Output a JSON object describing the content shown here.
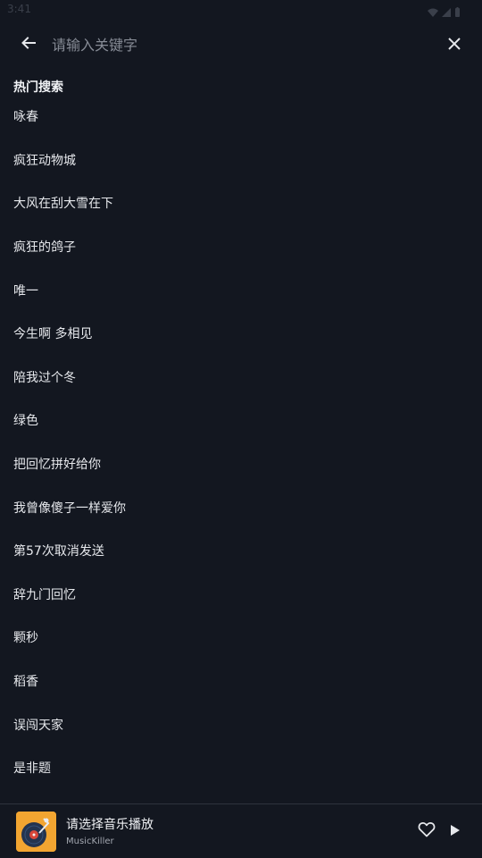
{
  "status_bar": {
    "time": "3:41",
    "icons": [
      "wifi-icon",
      "signal-icon",
      "battery-icon"
    ]
  },
  "search": {
    "placeholder": "请输入关键字",
    "value": "",
    "back_icon": "arrow-left-icon",
    "clear_icon": "close-icon"
  },
  "hot_search": {
    "title": "热门搜索",
    "items": [
      "咏春",
      "疯狂动物城",
      "大风在刮大雪在下",
      "疯狂的鸽子",
      "唯一",
      "今生啊 多相见",
      "陪我过个冬",
      "绿色",
      "把回忆拼好给你",
      "我曾像傻子一样爱你",
      "第57次取消发送",
      "辞九门回忆",
      "颗秒",
      "稻香",
      "误闯天家",
      "是非题"
    ]
  },
  "player": {
    "title": "请选择音乐播放",
    "artist": "MusicKiller",
    "cover_color": "#f2a531",
    "favorite_icon": "heart-outline-icon",
    "play_icon": "play-icon"
  },
  "colors": {
    "background": "#131720",
    "text": "#e6e8ec",
    "placeholder": "#868b95",
    "divider": "#2e333d"
  }
}
